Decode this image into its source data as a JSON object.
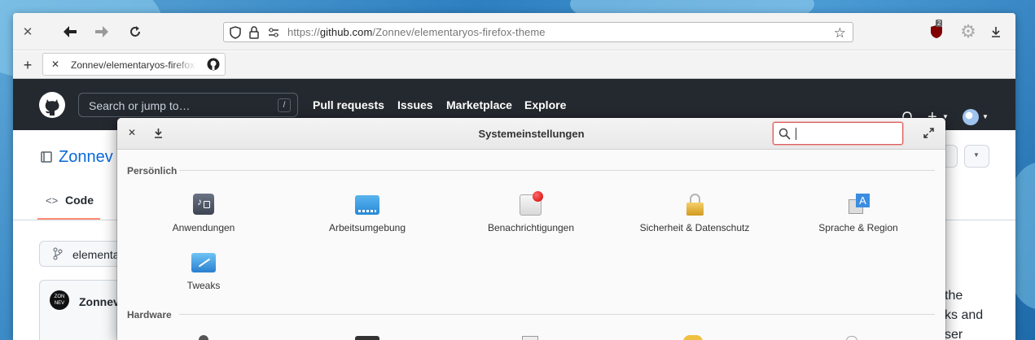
{
  "browser": {
    "url_prefix": "https://",
    "url_domain": "github.com",
    "url_path": "/Zonnev/elementaryos-firefox-theme",
    "ublock_badge": "2",
    "tab_title": "Zonnev/elementaryos-firefox-theme"
  },
  "github": {
    "search_placeholder": "Search or jump to…",
    "search_shortcut": "/",
    "nav": [
      "Pull requests",
      "Issues",
      "Marketplace",
      "Explore"
    ],
    "repo_title": "Zonnev / ",
    "code_tab": "Code",
    "branch_label": "elementa",
    "commit_author": "Zonnev",
    "avatar_text": "ZON NEV",
    "description_fragments": [
      "the",
      "ks and",
      "ser"
    ]
  },
  "dialog": {
    "title": "Systemeinstellungen",
    "search_value": "",
    "sections": [
      {
        "label": "Persönlich",
        "items": [
          {
            "label": "Anwendungen",
            "icon": "applications-icon"
          },
          {
            "label": "Arbeitsumgebung",
            "icon": "desktop-icon"
          },
          {
            "label": "Benachrichtigungen",
            "icon": "notifications-icon"
          },
          {
            "label": "Sicherheit & Datenschutz",
            "icon": "security-lock-icon"
          },
          {
            "label": "Sprache & Region",
            "icon": "language-icon"
          },
          {
            "label": "Tweaks",
            "icon": "tweaks-icon"
          }
        ]
      },
      {
        "label": "Hardware",
        "items": []
      }
    ]
  },
  "colors": {
    "github_header": "#24292f",
    "search_focus": "#e05a5a",
    "link_blue": "#0969da"
  }
}
